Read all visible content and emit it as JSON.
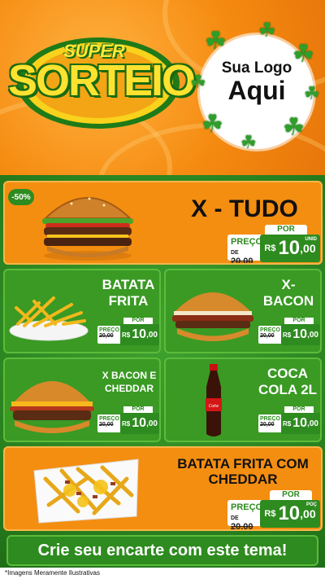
{
  "header": {
    "super": "SUPER",
    "sorteio": "SORTEIO",
    "logo_line1": "Sua Logo",
    "logo_line2": "Aqui"
  },
  "featured": {
    "discount": "-50%",
    "name": "X - TUDO",
    "price_label": "POR",
    "old_label": "PREÇO",
    "old_prefix": "DE",
    "old_price": "20,00",
    "currency": "R$",
    "price_int": "10",
    "price_dec": ",00",
    "unit": "UNID"
  },
  "items": [
    {
      "name_l1": "BATATA",
      "name_l2": "FRITA",
      "price_label": "POR",
      "old_label": "PREÇO",
      "old_prefix": "DE",
      "old_price": "20,00",
      "currency": "R$",
      "price_int": "10",
      "price_dec": ",00",
      "unit": "POÇ"
    },
    {
      "name_l1": "X-",
      "name_l2": "BACON",
      "price_label": "POR",
      "old_label": "PREÇO",
      "old_prefix": "DE",
      "old_price": "20,00",
      "currency": "R$",
      "price_int": "10",
      "price_dec": ",00",
      "unit": "UNID"
    },
    {
      "name_l1": "X BACON E",
      "name_l2": "CHEDDAR",
      "price_label": "POR",
      "old_label": "PREÇO",
      "old_prefix": "DE",
      "old_price": "20,00",
      "currency": "R$",
      "price_int": "10",
      "price_dec": ",00",
      "unit": "UNID"
    },
    {
      "name_l1": "COCA",
      "name_l2": "COLA 2L",
      "price_label": "POR",
      "old_label": "PREÇO",
      "old_prefix": "DE",
      "old_price": "20,00",
      "currency": "R$",
      "price_int": "10",
      "price_dec": ",00",
      "unit": "UNID"
    }
  ],
  "bottom_item": {
    "name_l1": "BATATA FRITA COM",
    "name_l2": "CHEDDAR",
    "price_label": "POR",
    "old_label": "PREÇO",
    "old_prefix": "DE",
    "old_price": "20,00",
    "currency": "R$",
    "price_int": "10",
    "price_dec": ",00",
    "unit": "POÇ"
  },
  "cta": "Crie seu encarte com este tema!",
  "disclaimer": "*Imagens Meramente Ilustrativas",
  "colors": {
    "orange": "#f48e10",
    "green": "#2e8b1f",
    "yellow": "#ffe230"
  }
}
